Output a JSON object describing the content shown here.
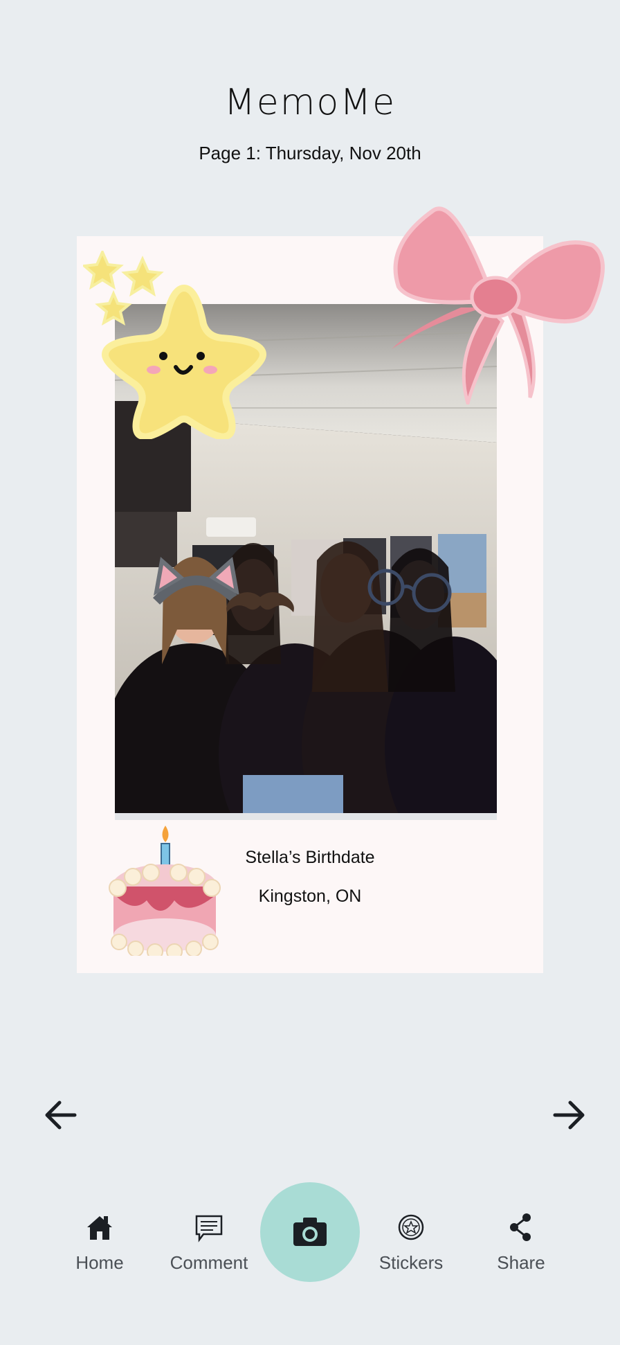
{
  "app": {
    "title": "MemoMe"
  },
  "page": {
    "subtitle": "Page 1: Thursday,  Nov 20th"
  },
  "card": {
    "caption_title": "Stella’s Birthdate",
    "caption_location": "Kingston, ON"
  },
  "nav": {
    "prev_icon": "arrow-left-icon",
    "next_icon": "arrow-right-icon"
  },
  "tabbar": {
    "items": [
      {
        "label": "Home",
        "icon": "home-icon"
      },
      {
        "label": "Comment",
        "icon": "comment-icon"
      },
      {
        "label": "",
        "icon": "camera-icon"
      },
      {
        "label": "Stickers",
        "icon": "sticker-icon"
      },
      {
        "label": "Share",
        "icon": "share-icon"
      }
    ]
  },
  "colors": {
    "background": "#e9edf0",
    "card": "#fdf7f7",
    "camera_button": "#a9dcd5",
    "tab_label": "#4a4f55"
  }
}
